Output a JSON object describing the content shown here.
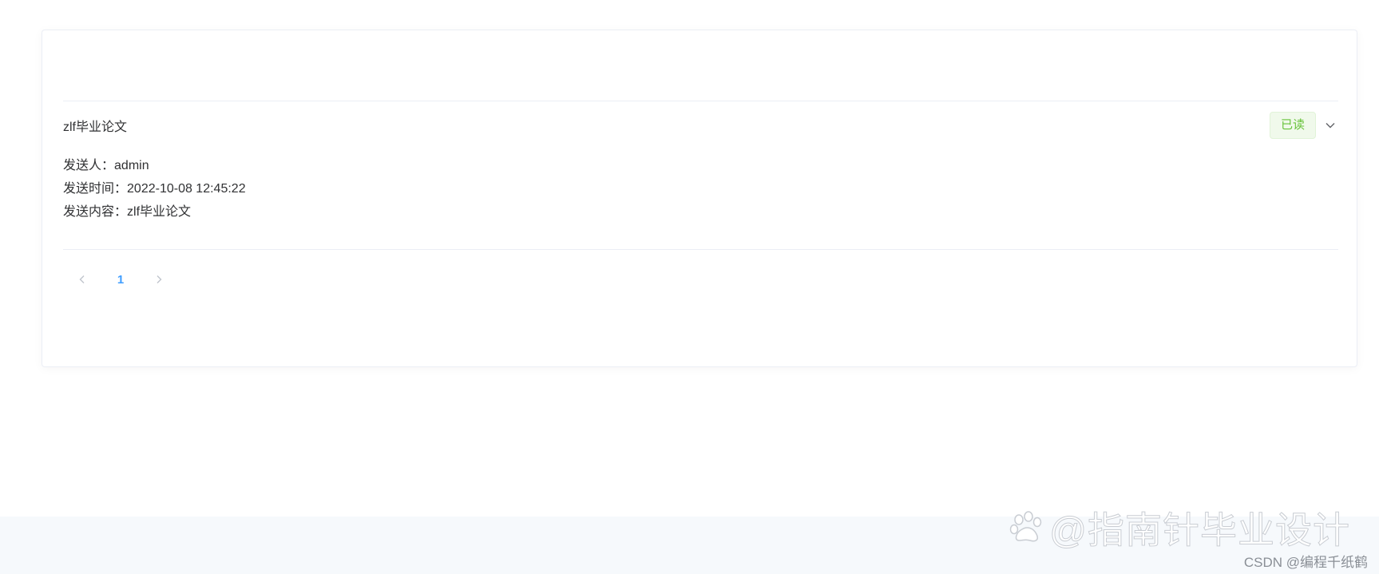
{
  "message": {
    "title": "zlf毕业论文",
    "status_tag": "已读",
    "expanded": true,
    "sender_label": "发送人：",
    "sender_value": "admin",
    "time_label": "发送时间：",
    "time_value": "2022-10-08 12:45:22",
    "content_label": "发送内容：",
    "content_value": "zlf毕业论文"
  },
  "pagination": {
    "current_page": "1",
    "prev_icon": "chevron-left-icon",
    "next_icon": "chevron-right-icon"
  },
  "icons": {
    "expand": "chevron-down-icon",
    "watermark_logo": "baidu-paw-icon"
  },
  "watermark": {
    "text": "@指南针毕业设计",
    "credit": "CSDN @编程千纸鹤"
  },
  "colors": {
    "tag_text": "#67c23a",
    "tag_bg": "#f0f9eb",
    "accent": "#409eff",
    "border": "#ebeef5"
  }
}
